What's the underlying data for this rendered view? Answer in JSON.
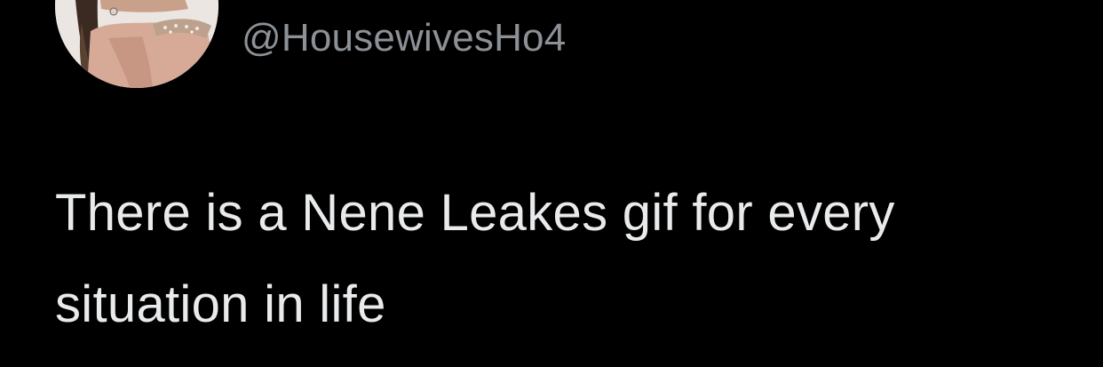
{
  "tweet": {
    "handle": "@HousewivesHo4",
    "text": "There is a Nene Leakes gif for every situation in life"
  },
  "colors": {
    "background": "#000000",
    "handle": "#8b9196",
    "text": "#e8eaec"
  },
  "icons": {
    "avatar": "profile-photo"
  }
}
